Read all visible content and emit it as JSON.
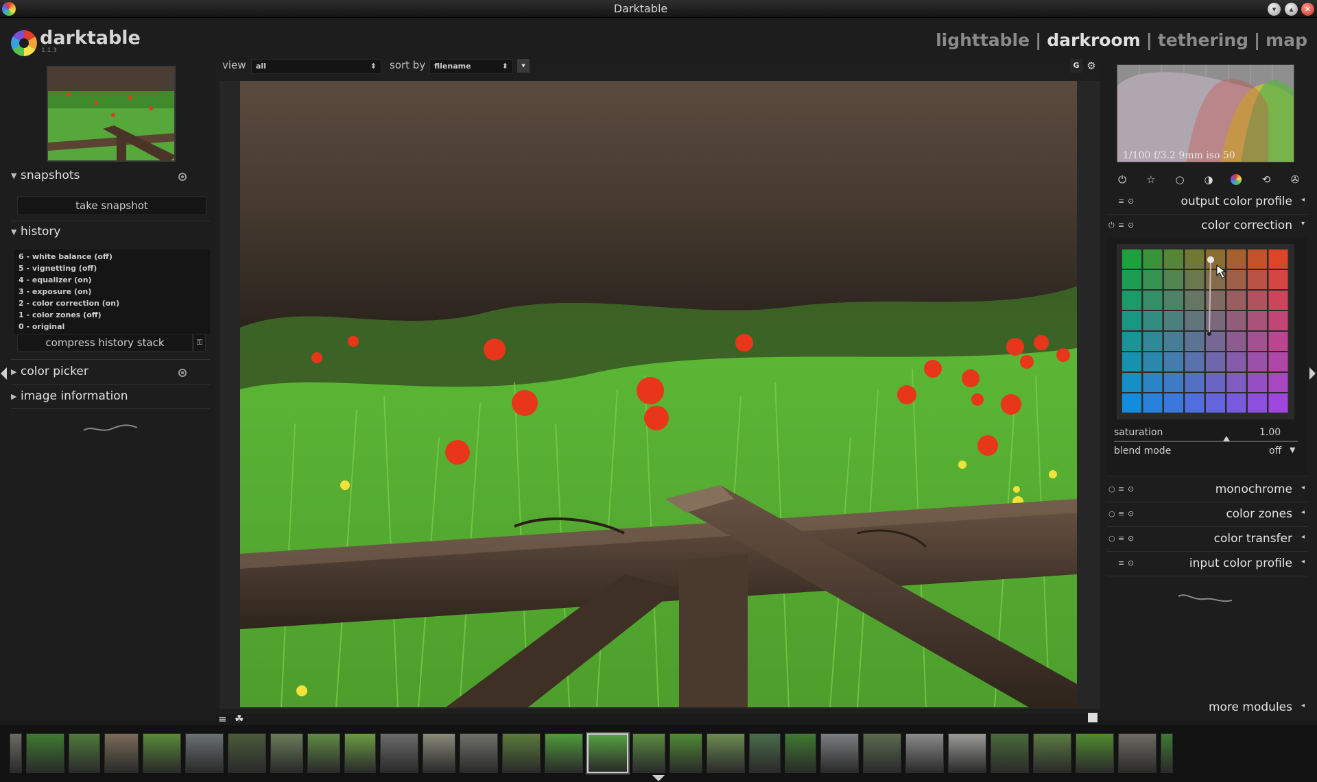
{
  "window": {
    "title": "Darktable"
  },
  "app": {
    "name": "darktable",
    "version": "1.1.3"
  },
  "views": {
    "lighttable": "lighttable",
    "darkroom": "darkroom",
    "tethering": "tethering",
    "map": "map",
    "active": "darkroom"
  },
  "filter": {
    "view_label": "view",
    "view_value": "all",
    "sort_label": "sort by",
    "sort_value": "filename",
    "g_label": "G"
  },
  "left": {
    "snapshots": {
      "title": "snapshots",
      "take_snapshot": "take snapshot"
    },
    "history": {
      "title": "history",
      "items": [
        "6 - white balance (off)",
        "5 - vignetting (off)",
        "4 - equalizer (on)",
        "3 - exposure (on)",
        "2 - color correction (on)",
        "1 - color zones (off)",
        "0 - original"
      ],
      "compress": "compress history stack"
    },
    "color_picker": {
      "title": "color picker"
    },
    "image_information": {
      "title": "image information"
    }
  },
  "right": {
    "histogram_info": "1/100 f/3.2 9mm iso 50",
    "modules": {
      "output_color_profile": "output color profile",
      "color_correction": "color correction",
      "monochrome": "monochrome",
      "color_zones": "color zones",
      "color_transfer": "color transfer",
      "input_color_profile": "input color profile"
    },
    "color_correction": {
      "saturation_label": "saturation",
      "saturation_value": "1.00",
      "blend_label": "blend mode",
      "blend_value": "off"
    },
    "more_modules": "more modules"
  },
  "colors": {
    "accent": "#e0e0e0",
    "panel": "#1d1d1d",
    "background": "#1a1a1a"
  }
}
